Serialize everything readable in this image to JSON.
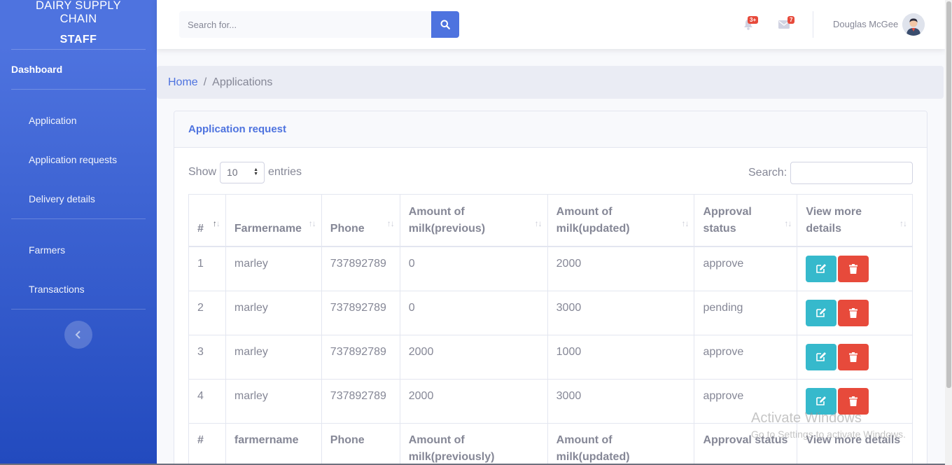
{
  "sidebar": {
    "brand_line1": "DAIRY SUPPLY",
    "brand_line2": "CHAIN",
    "role": "STAFF",
    "dashboard": "Dashboard",
    "items": [
      {
        "label": "Application"
      },
      {
        "label": "Application requests"
      },
      {
        "label": "Delivery details"
      },
      {
        "label": "Farmers"
      },
      {
        "label": "Transactions"
      }
    ]
  },
  "topbar": {
    "search_placeholder": "Search for...",
    "alerts_badge": "3+",
    "messages_badge": "7",
    "user_name": "Douglas McGee"
  },
  "breadcrumb": {
    "home": "Home",
    "separator": "/",
    "current": "Applications"
  },
  "card": {
    "title": "Application request",
    "show_label": "Show",
    "length_value": "10",
    "entries_label": "entries",
    "search_label": "Search:"
  },
  "table": {
    "headers": [
      "#",
      "Farmername",
      "Phone",
      "Amount of milk(previous)",
      "Amount of milk(updated)",
      "Approval status",
      "View more details"
    ],
    "rows": [
      {
        "num": "1",
        "farmer": "marley",
        "phone": "737892789",
        "prev": "0",
        "updated": "2000",
        "status": "approve"
      },
      {
        "num": "2",
        "farmer": "marley",
        "phone": "737892789",
        "prev": "0",
        "updated": "3000",
        "status": "pending"
      },
      {
        "num": "3",
        "farmer": "marley",
        "phone": "737892789",
        "prev": "2000",
        "updated": "1000",
        "status": "approve"
      },
      {
        "num": "4",
        "farmer": "marley",
        "phone": "737892789",
        "prev": "2000",
        "updated": "3000",
        "status": "approve"
      }
    ],
    "footers": [
      "#",
      "farmername",
      "Phone",
      "Amount of milk(previously)",
      "Amount of milk(updated)",
      "Approval status",
      "View more details"
    ]
  },
  "watermark": {
    "line1": "Activate Windows",
    "line2": "Go to Settings to activate Windows."
  },
  "colors": {
    "primary": "#4e73df",
    "info": "#36b9cc",
    "danger": "#e74a3b"
  }
}
